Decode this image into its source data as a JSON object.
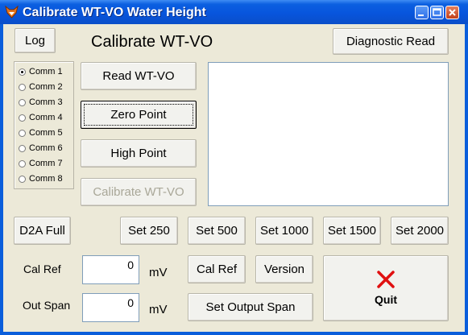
{
  "window": {
    "title": "Calibrate WT-VO Water Height",
    "icon": "fox-app-icon"
  },
  "header": {
    "heading": "Calibrate WT-VO",
    "log_label": "Log",
    "diagnostic_label": "Diagnostic Read"
  },
  "comms": {
    "selected": "Comm 1",
    "items": [
      {
        "label": "Comm 1",
        "checked": true
      },
      {
        "label": "Comm 2",
        "checked": false
      },
      {
        "label": "Comm 3",
        "checked": false
      },
      {
        "label": "Comm 4",
        "checked": false
      },
      {
        "label": "Comm 5",
        "checked": false
      },
      {
        "label": "Comm 6",
        "checked": false
      },
      {
        "label": "Comm 7",
        "checked": false
      },
      {
        "label": "Comm 8",
        "checked": false
      }
    ]
  },
  "actions": {
    "read_label": "Read WT-VO",
    "zero_label": "Zero Point",
    "high_label": "High Point",
    "calibrate_label": "Calibrate WT-VO"
  },
  "setpoints": {
    "d2a_label": "D2A Full",
    "buttons": [
      "Set 250",
      "Set 500",
      "Set 1000",
      "Set 1500",
      "Set 2000"
    ]
  },
  "cal_ref": {
    "label": "Cal Ref",
    "value": "0",
    "unit": "mV",
    "button_label": "Cal Ref"
  },
  "out_span": {
    "label": "Out Span",
    "value": "0",
    "unit": "mV",
    "button_label": "Set Output Span"
  },
  "version_label": "Version",
  "quit": {
    "label": "Quit",
    "icon": "red-x-icon",
    "icon_color": "#e01010"
  },
  "colors": {
    "titlebar": "#0855dd",
    "face": "#ece9d8"
  }
}
